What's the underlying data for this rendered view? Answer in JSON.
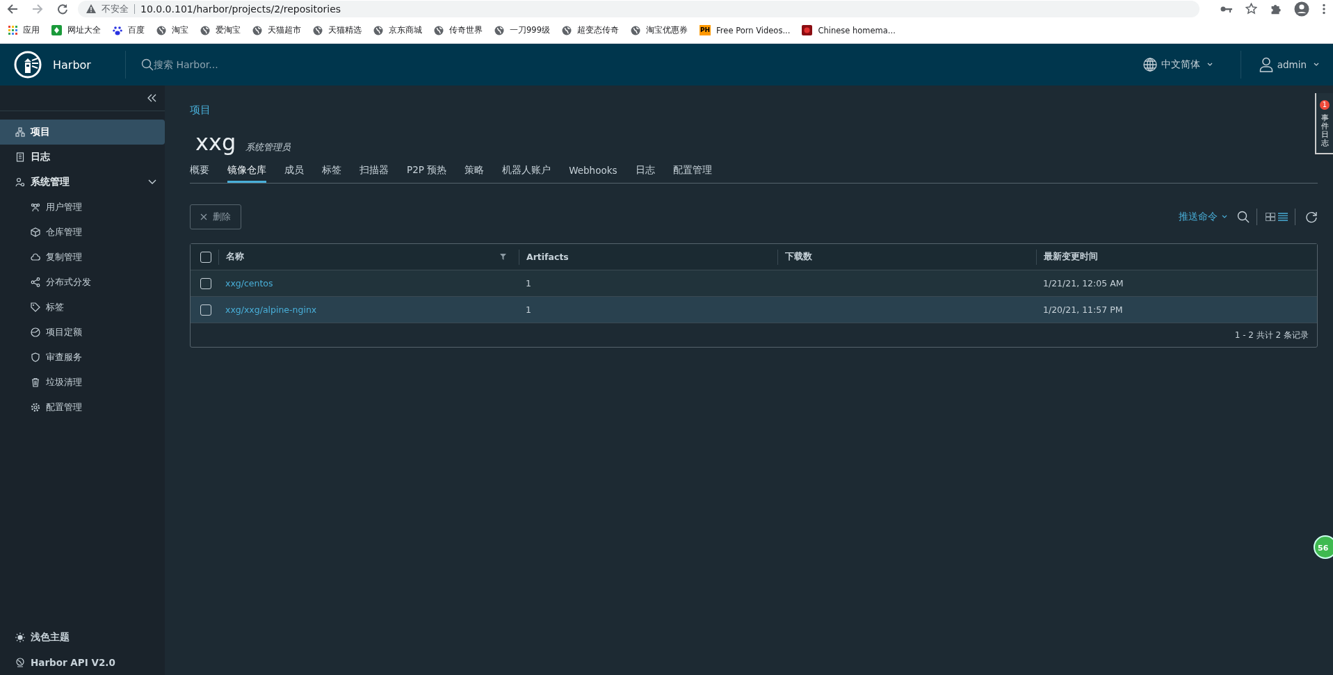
{
  "browser": {
    "security": "不安全",
    "url": "10.0.0.101/harbor/projects/2/repositories",
    "bookmarks": [
      {
        "label": "应用",
        "kind": "apps"
      },
      {
        "label": "网址大全",
        "kind": "green"
      },
      {
        "label": "百度",
        "kind": "paw"
      },
      {
        "label": "淘宝",
        "kind": "globe"
      },
      {
        "label": "爱淘宝",
        "kind": "globe"
      },
      {
        "label": "天猫超市",
        "kind": "globe"
      },
      {
        "label": "天猫精选",
        "kind": "globe"
      },
      {
        "label": "京东商城",
        "kind": "globe"
      },
      {
        "label": "传奇世界",
        "kind": "globe"
      },
      {
        "label": "一刀999级",
        "kind": "globe"
      },
      {
        "label": "超变态传奇",
        "kind": "globe"
      },
      {
        "label": "淘宝优惠券",
        "kind": "globe"
      },
      {
        "label": "Free Porn Videos...",
        "kind": "ph",
        "badge": "PH"
      },
      {
        "label": "Chinese homema...",
        "kind": "red"
      }
    ]
  },
  "header": {
    "app_name": "Harbor",
    "search_placeholder": "搜索 Harbor...",
    "language": "中文简体",
    "user": "admin"
  },
  "sidebar": {
    "items": [
      {
        "label": "项目",
        "selected": true
      },
      {
        "label": "日志",
        "selected": false
      },
      {
        "label": "系统管理",
        "selected": false,
        "expanded": true,
        "children": [
          {
            "label": "用户管理",
            "selected": false
          },
          {
            "label": "仓库管理",
            "selected": false
          },
          {
            "label": "复制管理",
            "selected": false
          },
          {
            "label": "分布式分发",
            "selected": false
          },
          {
            "label": "标签",
            "selected": false
          },
          {
            "label": "项目定额",
            "selected": false
          },
          {
            "label": "审查服务",
            "selected": false
          },
          {
            "label": "垃圾清理",
            "selected": false
          },
          {
            "label": "配置管理",
            "selected": false
          }
        ]
      }
    ],
    "footer": [
      "浅色主题",
      "Harbor API V2.0"
    ]
  },
  "breadcrumb": "项目",
  "project": {
    "name": "xxg",
    "role": "系统管理员"
  },
  "tabs": [
    {
      "label": "概要",
      "selected": false
    },
    {
      "label": "镜像仓库",
      "selected": true
    },
    {
      "label": "成员",
      "selected": false
    },
    {
      "label": "标签",
      "selected": false
    },
    {
      "label": "扫描器",
      "selected": false
    },
    {
      "label": "P2P 预热",
      "selected": false
    },
    {
      "label": "策略",
      "selected": false
    },
    {
      "label": "机器人账户",
      "selected": false
    },
    {
      "label": "Webhooks",
      "selected": false
    },
    {
      "label": "日志",
      "selected": false
    },
    {
      "label": "配置管理",
      "selected": false
    }
  ],
  "toolbar": {
    "delete": "删除",
    "push_command": "推送命令"
  },
  "table": {
    "select_all_checked": false,
    "columns": [
      "名称",
      "Artifacts",
      "下载数",
      "最新变更时间"
    ],
    "rows": [
      {
        "name": "xxg/centos",
        "artifacts": "1",
        "updated": "1/21/21, 12:05 AM",
        "checked": false,
        "hovered": false
      },
      {
        "name": "xxg/xxg/alpine-nginx",
        "artifacts": "1",
        "updated": "1/20/21, 11:57 PM",
        "checked": false,
        "hovered": true
      }
    ],
    "footer": "1 - 2 共计 2 条记录"
  },
  "event_panel": {
    "label": "事件日志",
    "count": "1"
  },
  "floating_badge": "56"
}
